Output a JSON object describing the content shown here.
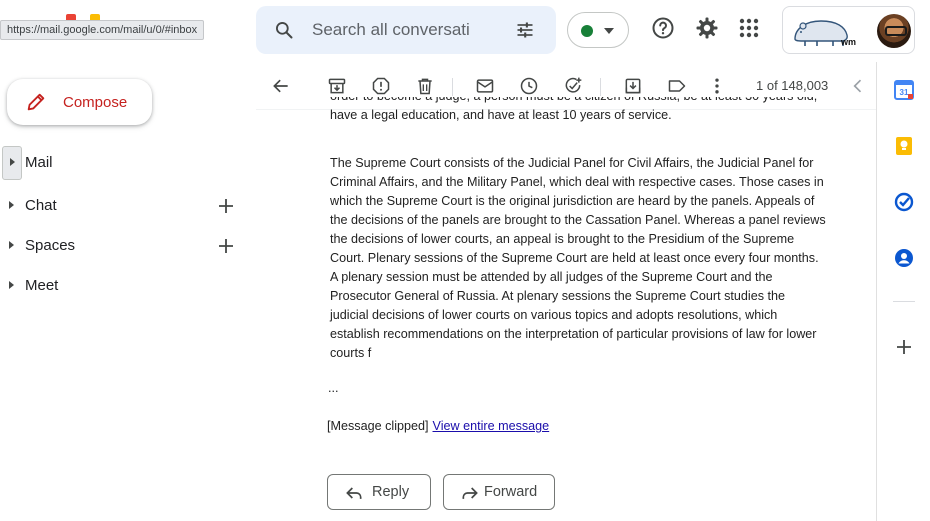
{
  "browser": {
    "status_url": "https://mail.google.com/mail/u/0/#inbox"
  },
  "search": {
    "placeholder": "Search all conversati"
  },
  "header": {
    "status_color": "#188038",
    "org_logo_text": "wm",
    "icons": [
      "search-icon",
      "tune-icon",
      "help-icon",
      "settings-icon",
      "apps-icon"
    ]
  },
  "sidebar": {
    "compose_label": "Compose",
    "items": [
      {
        "label": "Mail"
      },
      {
        "label": "Chat"
      },
      {
        "label": "Spaces"
      },
      {
        "label": "Meet"
      }
    ]
  },
  "toolbar": {
    "count": "1 of 148,003",
    "icons": [
      "back-icon",
      "archive-icon",
      "report-spam-icon",
      "delete-icon",
      "mark-unread-icon",
      "snooze-icon",
      "add-task-icon",
      "move-to-icon",
      "label-icon",
      "more-icon",
      "prev-icon"
    ]
  },
  "message": {
    "partial_top": "order to become a judge, a person must be a citizen of Russia, be at least 30 years old, have a legal education, and have at least 10 years of service.",
    "body": "The Supreme Court consists of the Judicial Panel for Civil Affairs, the Judicial Panel for Criminal Affairs, and the Military Panel, which deal with respective cases. Those cases in which the Supreme Court is the original jurisdiction are heard by the panels. Appeals of the decisions of the panels are brought to the Cassation Panel. Whereas a panel reviews the decisions of lower courts, an appeal is brought to the Presidium of the Supreme Court. Plenary sessions of the Supreme Court are held at least once every four months. A plenary session must be attended by all judges of the Supreme Court and the Prosecutor General of Russia. At plenary sessions the Supreme Court studies the judicial decisions of lower courts on various topics and adopts resolutions, which establish recommendations on the interpretation of particular provisions of law for lower courts f",
    "ellipsis": "...",
    "clipped": "[Message clipped]",
    "view_entire": "View entire message"
  },
  "actions": {
    "reply": "Reply",
    "forward": "Forward"
  },
  "rail": {
    "calendar_day": "31",
    "icons": [
      "calendar-icon",
      "keep-icon",
      "tasks-icon",
      "contacts-icon",
      "add-addon-icon"
    ]
  },
  "colors": {
    "accent_red": "#c5221f",
    "search_bg": "#eaf1fb",
    "link": "#1a0dab",
    "keep_yellow": "#fbbc04",
    "tasks_blue": "#0b57d0"
  }
}
